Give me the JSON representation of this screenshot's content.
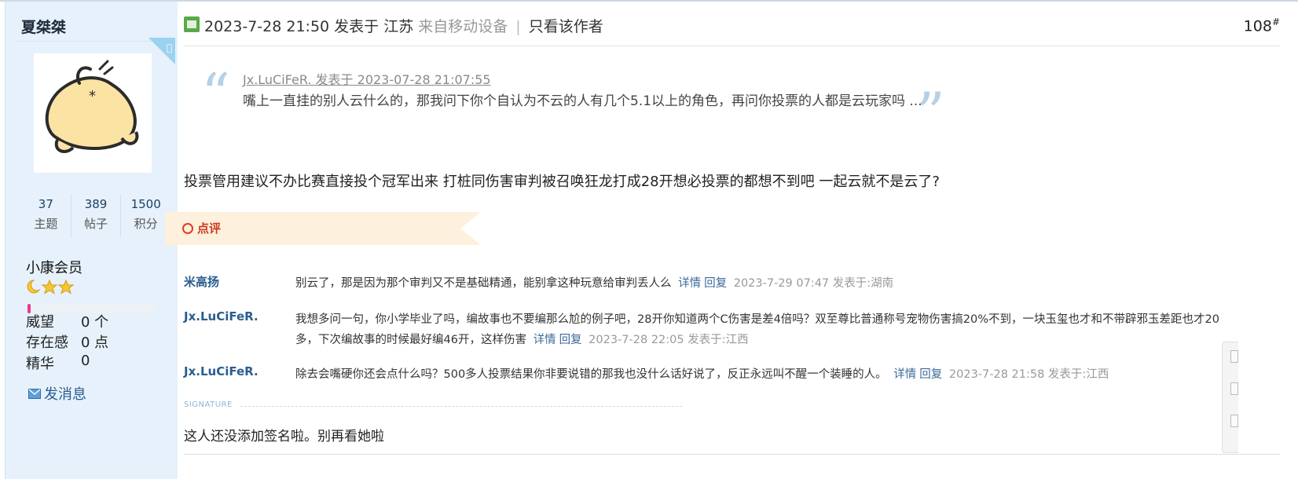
{
  "user": {
    "name": "夏桀桀",
    "stats": [
      {
        "value": "37",
        "label": "主题"
      },
      {
        "value": "389",
        "label": "帖子"
      },
      {
        "value": "1500",
        "label": "积分"
      }
    ],
    "level": "小康会员",
    "level_progress": 0.02,
    "props": [
      {
        "label": "威望",
        "value": "0 个"
      },
      {
        "label": "存在感",
        "value": "0 点"
      },
      {
        "label": "精华",
        "value": "0"
      }
    ],
    "send_message": "发消息"
  },
  "post": {
    "time": "2023-7-28 21:50",
    "posted_in": "发表于 江苏",
    "device": "来自移动设备",
    "separator": "|",
    "only_author": "只看该作者",
    "floor": "108",
    "floor_mark": "#",
    "quote_author": "Jx.LuCiFeR. 发表于 2023-07-28 21:07:55",
    "quote_text": "嘴上一直挂的别人云什么的，那我问下你个自认为不云的人有几个5.1以上的角色，再问你投票的人都是云玩家吗 ...",
    "body": "投票管用建议不办比赛直接投个冠军出来 打桩同伤害审判被召唤狂龙打成28开想必投票的都想不到吧 一起云就不是云了?"
  },
  "rating": {
    "label": "点评",
    "comments": [
      {
        "name": "米高扬",
        "text": "别云了，那是因为那个审判又不是基础精通，能别拿这种玩意给审判丢人么",
        "detail": "详情",
        "reply": "回复",
        "meta": "2023-7-29 07:47 发表于:湖南"
      },
      {
        "name": "Jx.LuCiFeR.",
        "text": "我想多问一句，你小学毕业了吗，编故事也不要编那么尬的例子吧，28开你知道两个C伤害是差4倍吗？双至尊比普通称号宠物伤害搞20%不到，一块玉玺也才和不带辟邪玉差距也才20多，下次编故事的时候最好编46开，这样伤害",
        "detail": "详情",
        "reply": "回复",
        "meta": "2023-7-28 22:05 发表于:江西"
      },
      {
        "name": "Jx.LuCiFeR.",
        "text": "除去会嘴硬你还会点什么吗？500多人投票结果你非要说错的那我也没什么话好说了，反正永远叫不醒一个装睡的人。",
        "detail": "详情",
        "reply": "回复",
        "meta": "2023-7-28 21:58 发表于:江西"
      }
    ]
  },
  "signature": {
    "label": "SIGNATURE",
    "text": "这人还没添加签名啦。别再看她啦"
  },
  "colors": {
    "sidebar_bg": "#e6f1fb",
    "link": "#2a5d8f",
    "rating_banner": "#fdf0dc",
    "rating_text": "#cc3a1e"
  }
}
